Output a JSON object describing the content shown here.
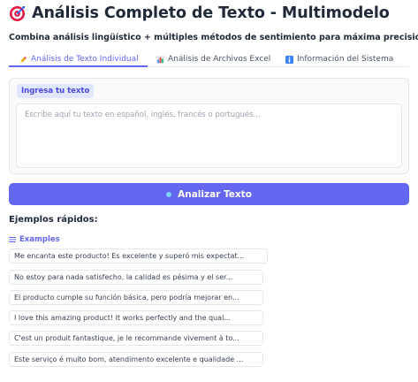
{
  "header": {
    "title": "Análisis Completo de Texto - Multimodelo",
    "icon": "target-icon",
    "subtitle": "Combina análisis lingüístico + múltiples métodos de sentimiento para máxima precisión"
  },
  "tabs": [
    {
      "label": "Análisis de Texto Individual",
      "icon": "pencil-icon",
      "active": true
    },
    {
      "label": "Análisis de Archivos Excel",
      "icon": "bar-chart-icon",
      "active": false
    },
    {
      "label": "Información del Sistema",
      "icon": "info-icon",
      "active": false
    }
  ],
  "input": {
    "label": "Ingresa tu texto",
    "value": "",
    "placeholder": "Escribe aquí tu texto en español, inglés, francés o portugués..."
  },
  "analyze_button": {
    "label": "Analizar Texto"
  },
  "quick_examples": {
    "heading": "Ejemplos rápidos:",
    "label": "Examples",
    "items": [
      "Me encanta este producto! Es excelente y superó mis expectat...",
      "No estoy para nada satisfecho, la calidad es pésima y el ser...",
      "El producto cumple su función básica, pero podría mejorar en...",
      "I love this amazing product! It works perfectly and the qual...",
      "C'est un produit fantastique, je le recommande vivement à to...",
      "Este serviço é muito bom, atendimento excelente e qualidade ..."
    ]
  },
  "colors": {
    "accent": "#6366f1",
    "label_bg": "#e0e7ff",
    "text": "#1f2937"
  }
}
